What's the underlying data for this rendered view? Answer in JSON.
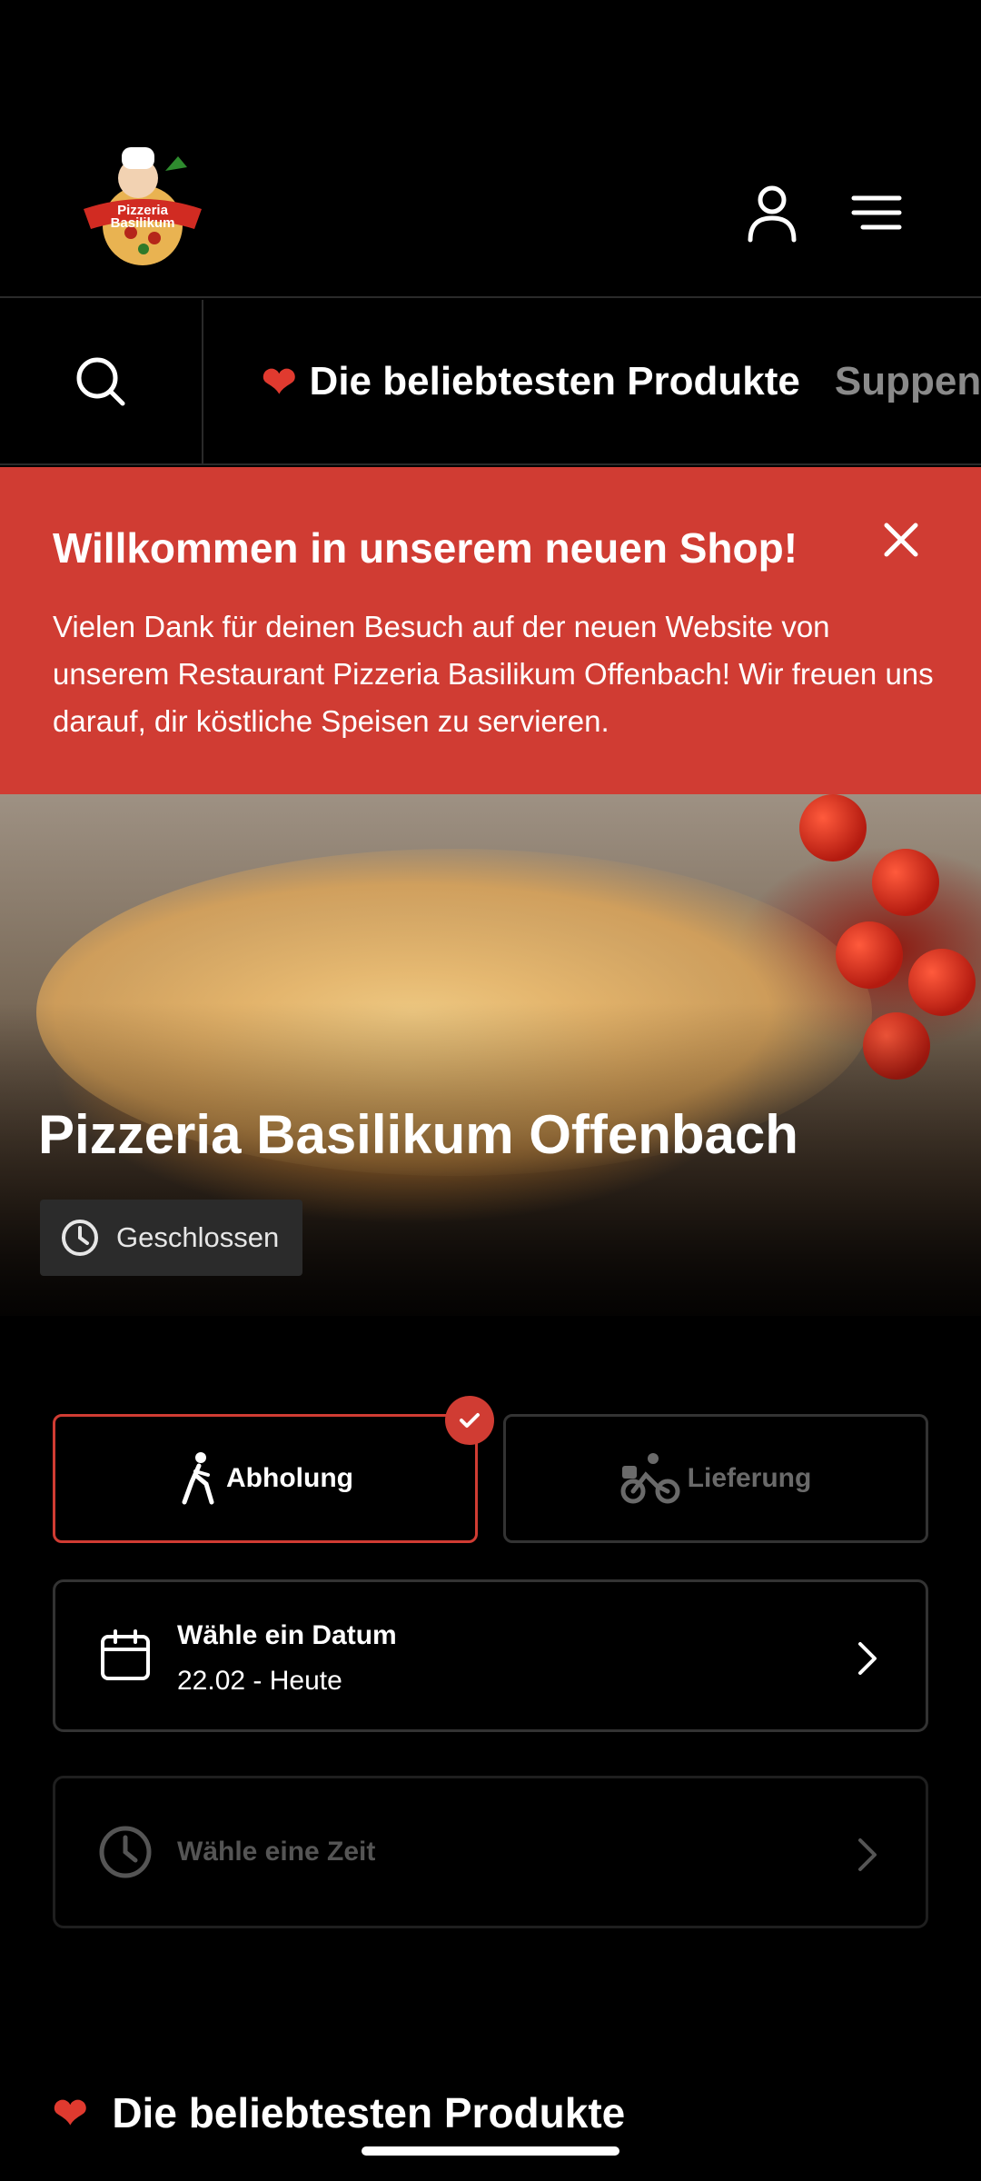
{
  "colors": {
    "accent": "#d03c33",
    "background": "#000000",
    "muted": "#8a8a8a"
  },
  "header": {
    "logo_line1": "Pizzeria",
    "logo_line2": "Basilikum",
    "icons": [
      "account-icon",
      "hamburger-menu-icon"
    ]
  },
  "categories": {
    "items": [
      {
        "label": "Die beliebtesten Produkte",
        "icon": "heart-icon",
        "active": true
      },
      {
        "label": "Suppen",
        "active": false
      }
    ]
  },
  "banner": {
    "title": "Willkommen in unserem neuen Shop!",
    "text": "Vielen Dank für deinen Besuch auf der neuen Website von unserem Restaurant Pizzeria Basilikum Offenbach! Wir freuen uns darauf, dir köstliche Speisen zu servieren."
  },
  "hero": {
    "title": "Pizzeria Basilikum Offenbach",
    "status": "Geschlossen"
  },
  "order_mode": {
    "pickup_label": "Abholung",
    "delivery_label": "Lieferung",
    "selected": "pickup"
  },
  "date_picker": {
    "label": "Wähle ein Datum",
    "value": "22.02 - Heute"
  },
  "time_picker": {
    "label": "Wähle eine Zeit"
  },
  "section": {
    "title": "Die beliebtesten Produkte"
  }
}
